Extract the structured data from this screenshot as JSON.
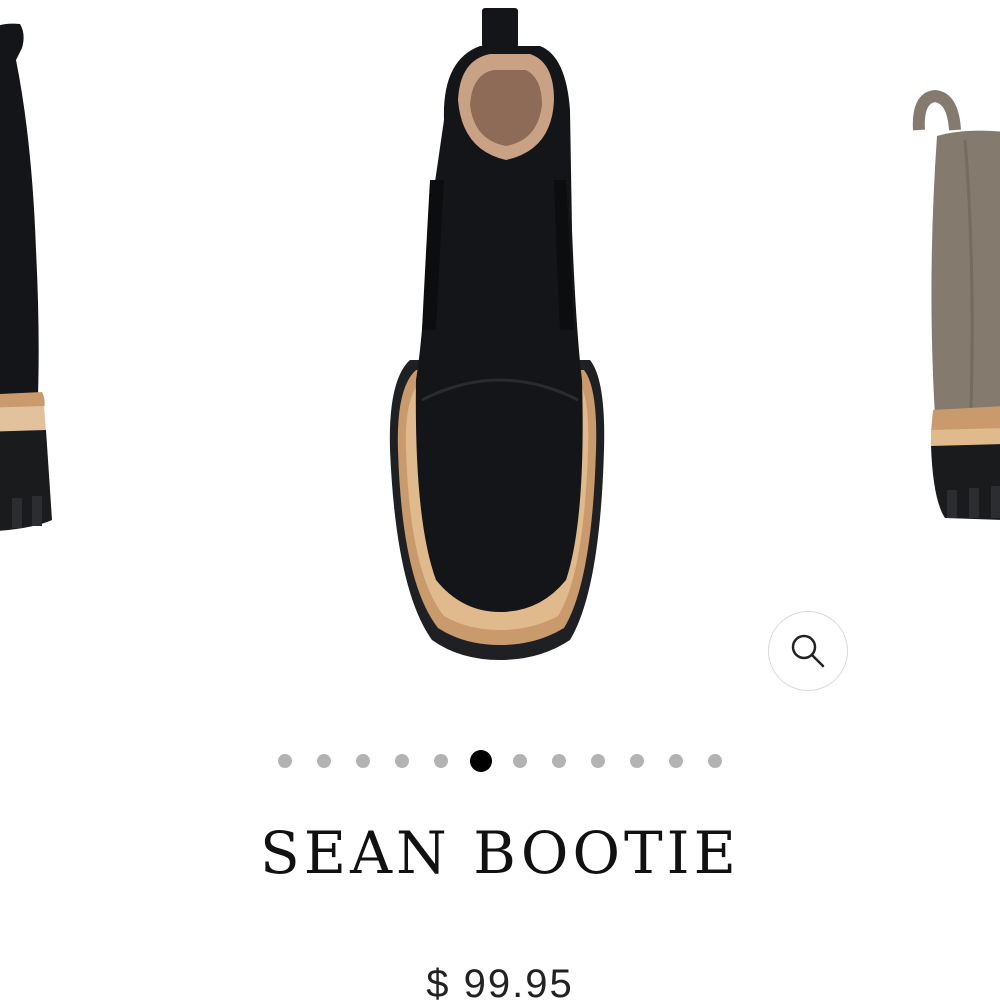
{
  "product": {
    "title": "SEAN BOOTIE",
    "price": "$ 99.95"
  },
  "carousel": {
    "slide_count": 12,
    "active_index": 5
  },
  "icons": {
    "zoom": "search-icon"
  },
  "colors": {
    "boot_black": "#141518",
    "boot_taupe": "#857a6e",
    "welt_tan": "#c99a6c",
    "dot_inactive": "#b3b3b3",
    "dot_active": "#000000"
  }
}
